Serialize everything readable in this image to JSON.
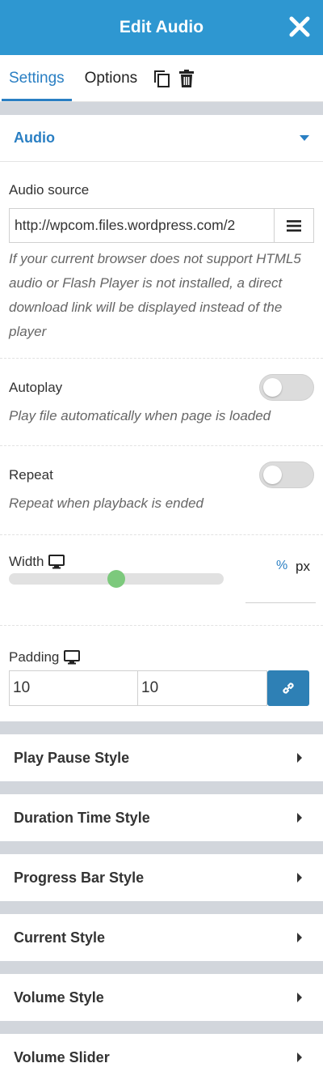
{
  "header": {
    "title": "Edit Audio"
  },
  "tabs": {
    "settings": "Settings",
    "options": "Options"
  },
  "audio_section": {
    "title": "Audio",
    "source": {
      "label": "Audio source",
      "value": "http://wpcom.files.wordpress.com/2",
      "description": "If your current browser does not support HTML5 audio or Flash Player is not installed, a direct download link will be displayed instead of the player"
    },
    "autoplay": {
      "label": "Autoplay",
      "enabled": false,
      "description": "Play file automatically when page is loaded"
    },
    "repeat": {
      "label": "Repeat",
      "enabled": false,
      "description": "Repeat when playback is ended"
    },
    "width": {
      "label": "Width",
      "unit_percent": "%",
      "unit_px": "px",
      "active_unit": "%",
      "slider_fraction": 0.5,
      "value": ""
    },
    "padding": {
      "label": "Padding",
      "top": "10",
      "bottom": "10"
    }
  },
  "sections": [
    {
      "title": "Play Pause Style"
    },
    {
      "title": "Duration Time Style"
    },
    {
      "title": "Progress Bar Style"
    },
    {
      "title": "Current Style"
    },
    {
      "title": "Volume Style"
    },
    {
      "title": "Volume Slider"
    }
  ],
  "colors": {
    "header": "#2e97d1",
    "accent": "#2a7fc3",
    "slider_thumb": "#7cc97c",
    "link_button": "#2e80b5",
    "separator": "#d2d6dc"
  },
  "icons": [
    "close-icon",
    "duplicate-icon",
    "trash-icon",
    "caret-down-icon",
    "menu-icon",
    "desktop-icon",
    "link-icon",
    "caret-right-icon"
  ]
}
